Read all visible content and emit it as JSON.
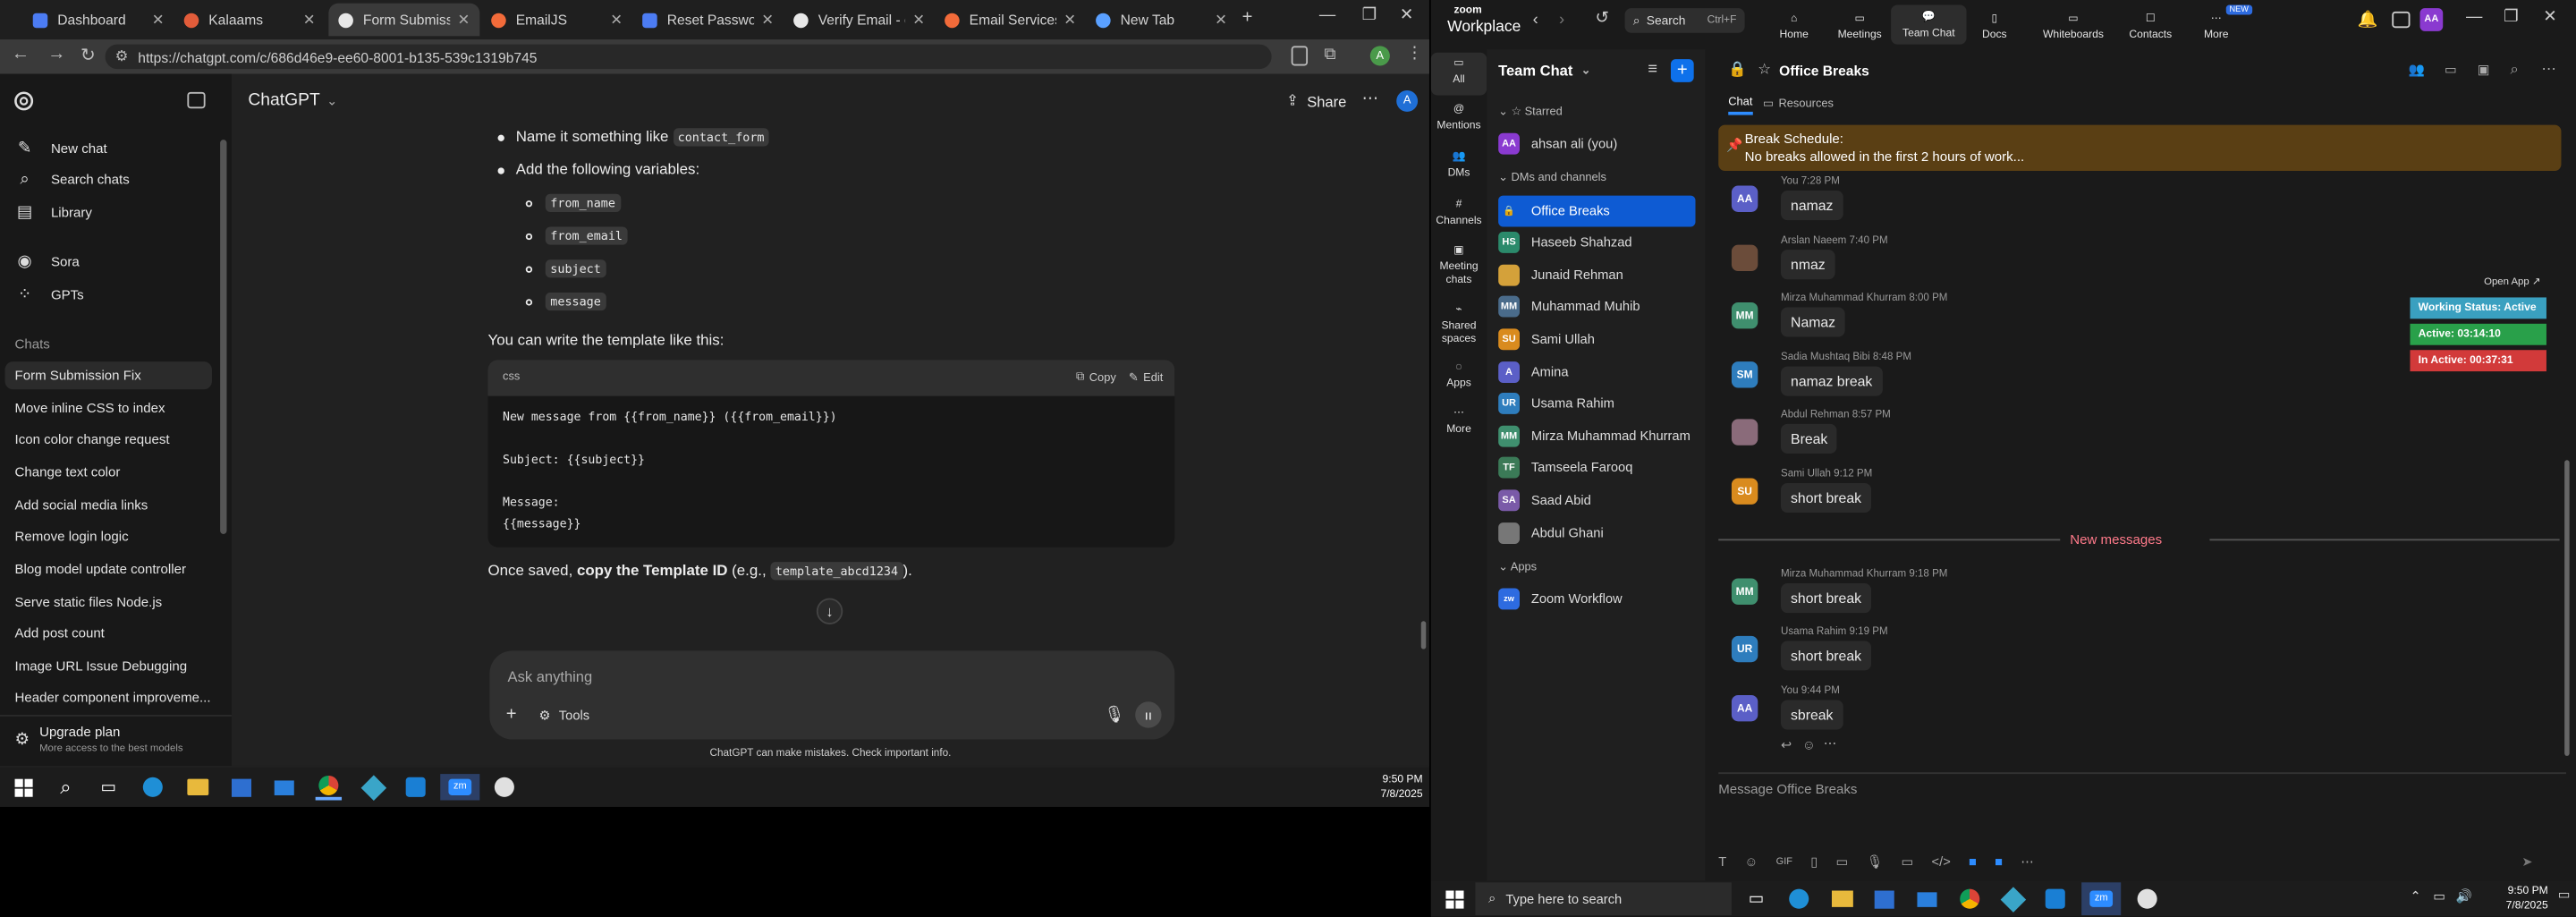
{
  "chrome": {
    "tabs": [
      {
        "title": "Dashboard",
        "color": "#4c7cf3"
      },
      {
        "title": "Kalaams",
        "color": "#e25c3a"
      },
      {
        "title": "Form Submission",
        "color": "#e8e8e8"
      },
      {
        "title": "EmailJS",
        "color": "#f26b3a"
      },
      {
        "title": "Reset Password - E",
        "color": "#4c7cf3"
      },
      {
        "title": "Verify Email - con",
        "color": "#e8e8e8"
      },
      {
        "title": "Email Services - Er",
        "color": "#f26b3a"
      },
      {
        "title": "New Tab",
        "color": "#5aa0ff"
      }
    ],
    "new_tab_symbol": "+",
    "url": "https://chatgpt.com/c/686d46e9-ee60-8001-b135-539c1319b745",
    "profile_initial": "A"
  },
  "chatgpt": {
    "sidebar": {
      "new_chat": "New chat",
      "search_chats": "Search chats",
      "library": "Library",
      "sora": "Sora",
      "gpts": "GPTs",
      "chats_heading": "Chats",
      "chats": [
        "Form Submission Fix",
        "Move inline CSS to index",
        "Icon color change request",
        "Change text color",
        "Add social media links",
        "Remove login logic",
        "Blog model update controller",
        "Serve static files Node.js",
        "Add post count",
        "Image URL Issue Debugging",
        "Header component improveme..."
      ],
      "upgrade_title": "Upgrade plan",
      "upgrade_sub": "More access to the best models"
    },
    "header": {
      "model": "ChatGPT",
      "share": "Share",
      "avatar": "A"
    },
    "content": {
      "line1_pre": "Name it something like",
      "line1_code": "contact_form",
      "line2": "Add the following variables:",
      "vars": [
        "from_name",
        "from_email",
        "subject",
        "message"
      ],
      "template_intro": "You can write the template like this:",
      "code_lang": "css",
      "copy": "Copy",
      "edit": "Edit",
      "code_lines": [
        "New message from {{from_name}} ({{from_email}})",
        "",
        "Subject: {{subject}}",
        "",
        "Message:",
        "{{message}}"
      ],
      "saved_pre": "Once saved,",
      "saved_bold": "copy the Template ID",
      "saved_mid": "(e.g.,",
      "saved_code": "template_abcd1234",
      "saved_post": ")."
    },
    "composer": {
      "placeholder": "Ask anything",
      "tools": "Tools"
    },
    "disclaimer": "ChatGPT can make mistakes. Check important info."
  },
  "taskbar_left": {
    "time": "9:50 PM",
    "date": "7/8/2025"
  },
  "zoom": {
    "brand_top": "zoom",
    "brand_bottom": "Workplace",
    "search": "Search",
    "search_shortcut": "Ctrl+F",
    "nav": [
      "Home",
      "Meetings",
      "Team Chat",
      "Docs",
      "Whiteboards",
      "Contacts",
      "More"
    ],
    "new_badge": "NEW",
    "rail": [
      {
        "label": "All"
      },
      {
        "label": "Mentions"
      },
      {
        "label": "DMs"
      },
      {
        "label": "Channels"
      },
      {
        "label": "Meeting chats"
      },
      {
        "label": "Shared spaces"
      },
      {
        "label": "Apps"
      },
      {
        "label": "More"
      }
    ],
    "list_title": "Team Chat",
    "starred": "Starred",
    "starred_item": "ahsan ali (you)",
    "dms_heading": "DMs and channels",
    "dms": [
      {
        "name": "Office Breaks",
        "init": "",
        "color": "#2d6be0"
      },
      {
        "name": "Haseeb Shahzad",
        "init": "HS",
        "color": "#2b8a6b"
      },
      {
        "name": "Junaid Rehman",
        "init": "",
        "color": "#d4a13a"
      },
      {
        "name": "Muhammad Muhib",
        "init": "MM",
        "color": "#4a6b8a"
      },
      {
        "name": "Sami Ullah",
        "init": "SU",
        "color": "#d98b1e"
      },
      {
        "name": "Amina",
        "init": "A",
        "color": "#5b5fc7"
      },
      {
        "name": "Usama Rahim",
        "init": "UR",
        "color": "#2e7dbd"
      },
      {
        "name": "Mirza Muhammad Khurram",
        "init": "MM",
        "color": "#3f8f6e"
      },
      {
        "name": "Tamseela Farooq",
        "init": "TF",
        "color": "#3b7a57"
      },
      {
        "name": "Saad Abid",
        "init": "SA",
        "color": "#7a5aa8"
      },
      {
        "name": "Abdul Ghani",
        "init": "",
        "color": "#777777"
      }
    ],
    "apps_heading": "Apps",
    "app_item": "Zoom Workflow",
    "channel_title": "Office Breaks",
    "chat_tab": "Chat",
    "resources_tab": "Resources",
    "banner_title": "Break Schedule:",
    "banner_body": "No breaks allowed in the first 2 hours of work...",
    "open_app": "Open App",
    "status": {
      "working": "Working Status: Active",
      "active": "Active: 03:14:10",
      "inactive": "In Active: 00:37:31"
    },
    "messages": [
      {
        "init": "AA",
        "color": "#5b5fc7",
        "header": "You 7:28 PM",
        "text": "namaz"
      },
      {
        "init": "",
        "color": "#6b4c3a",
        "header": "Arslan Naeem 7:40 PM",
        "text": "nmaz"
      },
      {
        "init": "MM",
        "color": "#3f8f6e",
        "header": "Mirza Muhammad Khurram 8:00 PM",
        "text": "Namaz"
      },
      {
        "init": "SM",
        "color": "#2e7dbd",
        "header": "Sadia Mushtaq Bibi 8:48 PM",
        "text": "namaz  break"
      },
      {
        "init": "",
        "color": "#8a6b7a",
        "header": "Abdul Rehman 8:57 PM",
        "text": "Break"
      },
      {
        "init": "SU",
        "color": "#d98b1e",
        "header": "Sami Ullah 9:12 PM",
        "text": "short break"
      },
      {
        "init": "MM",
        "color": "#3f8f6e",
        "header": "Mirza Muhammad Khurram 9:18 PM",
        "text": "short break"
      },
      {
        "init": "UR",
        "color": "#2e7dbd",
        "header": "Usama Rahim 9:19 PM",
        "text": "short break"
      },
      {
        "init": "AA",
        "color": "#5b5fc7",
        "header": "You 9:44 PM",
        "text": "sbreak"
      }
    ],
    "new_messages": "New messages",
    "composer_placeholder": "Message Office Breaks"
  },
  "taskbar_right": {
    "search": "Type here to search",
    "time": "9:50 PM",
    "date": "7/8/2025"
  }
}
